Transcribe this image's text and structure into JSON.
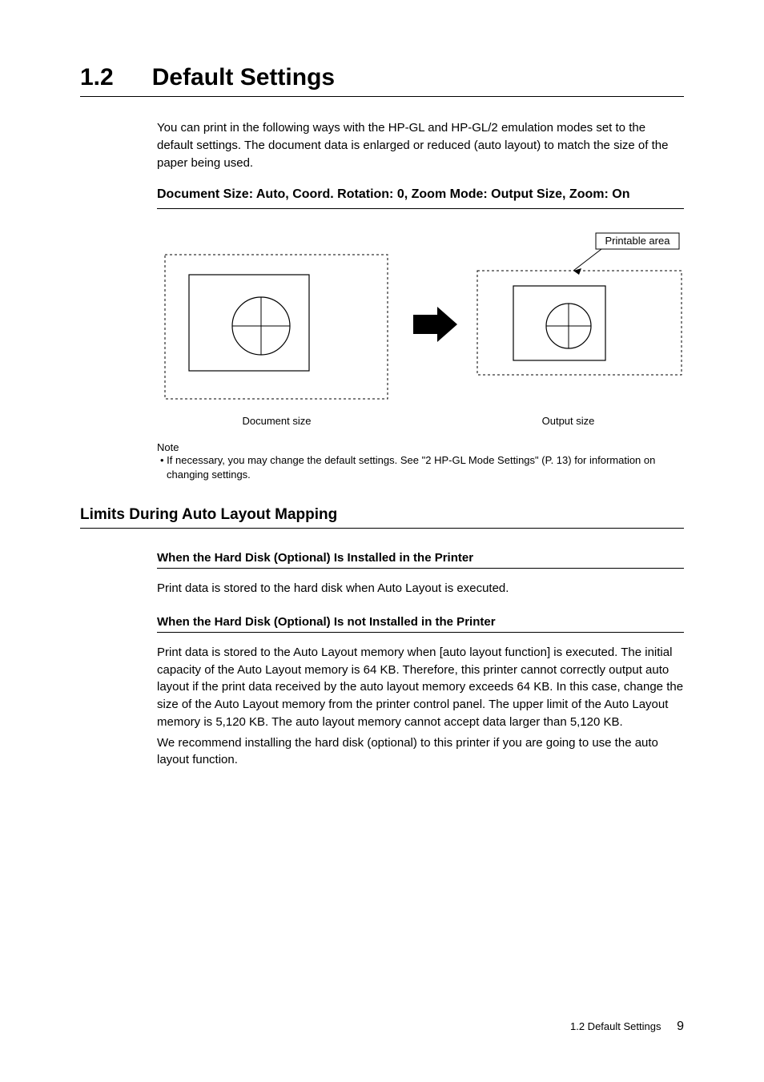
{
  "heading": {
    "num": "1.2",
    "title": "Default Settings"
  },
  "intro": "You can print in the following ways with the HP-GL and HP-GL/2 emulation modes set to the default settings. The document data is enlarged or reduced (auto layout) to match the size of the paper being used.",
  "h3": "Document Size: Auto, Coord. Rotation: 0, Zoom Mode: Output Size, Zoom: On",
  "diagram": {
    "printable_label": "Printable area",
    "doc_caption": "Document size",
    "out_caption": "Output size"
  },
  "note_label": "Note",
  "note_body": "• If necessary, you may change the default settings. See \"2 HP-GL Mode Settings\" (P. 13) for information on changing settings.",
  "h2": "Limits During Auto Layout Mapping",
  "sec1": {
    "title": "When the Hard Disk (Optional) Is Installed in the Printer",
    "body": "Print data is stored to the hard disk when Auto Layout is executed."
  },
  "sec2": {
    "title": "When the Hard Disk (Optional) Is not Installed in the Printer",
    "body1": "Print data is stored to the Auto Layout memory when [auto layout function] is executed. The initial capacity of the Auto Layout memory is 64 KB. Therefore, this printer cannot correctly output auto layout if the print data received by the auto layout memory exceeds 64 KB. In this case, change the size of the Auto Layout memory from the printer control panel. The upper limit of the Auto Layout memory is 5,120 KB. The auto layout memory cannot accept data larger than 5,120 KB.",
    "body2": "We recommend installing the hard disk (optional) to this printer if you are going to use the auto layout function."
  },
  "footer": {
    "section": "1.2 Default Settings",
    "page": "9"
  }
}
